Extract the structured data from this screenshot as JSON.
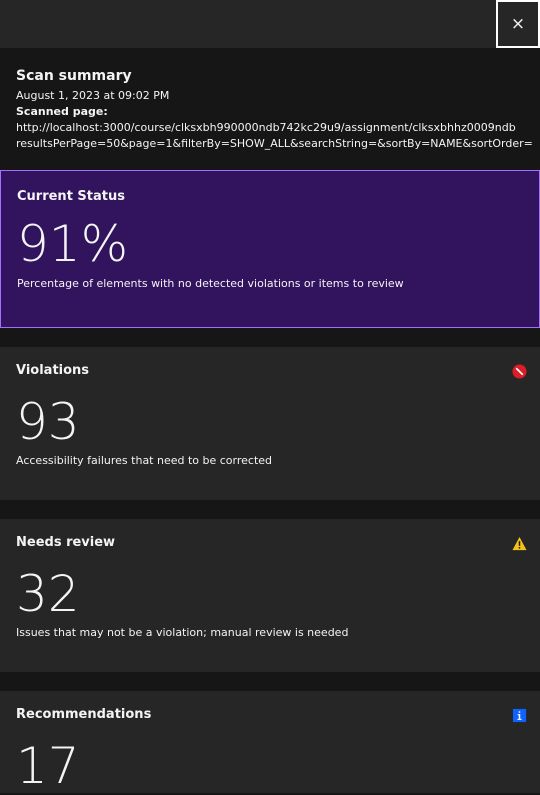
{
  "header": {
    "close_label": "×"
  },
  "summary": {
    "title": "Scan summary",
    "date": "August 1, 2023 at 09:02 PM",
    "scanned_label": "Scanned page:",
    "url_line1": "http://localhost:3000/course/clksxbh990000ndb742kc29u9/assignment/clksxbhhz0009ndb",
    "url_line2": "resultsPerPage=50&page=1&filterBy=SHOW_ALL&searchString=&sortBy=NAME&sortOrder="
  },
  "cards": {
    "status": {
      "title": "Current Status",
      "value": "91%",
      "description": "Percentage of elements with no detected violations or items to review"
    },
    "violations": {
      "title": "Violations",
      "value": "93",
      "description": "Accessibility failures that need to be corrected",
      "icon": "violation-icon",
      "color": "#da1e28"
    },
    "review": {
      "title": "Needs review",
      "value": "32",
      "description": "Issues that may not be a violation; manual review is needed",
      "icon": "warning-icon",
      "color": "#f1c21b"
    },
    "recommendations": {
      "title": "Recommendations",
      "value": "17",
      "icon": "info-icon",
      "color": "#0f62fe"
    }
  }
}
